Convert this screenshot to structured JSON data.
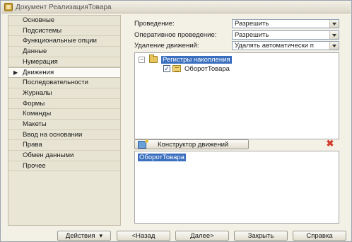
{
  "window": {
    "title": "Документ РеализацияТовара"
  },
  "nav": {
    "items": [
      {
        "label": "Основные"
      },
      {
        "label": "Подсистемы"
      },
      {
        "label": "Функциональные опции"
      },
      {
        "label": "Данные"
      },
      {
        "label": "Нумерация"
      },
      {
        "label": "Движения",
        "active": true
      },
      {
        "label": "Последовательности"
      },
      {
        "label": "Журналы"
      },
      {
        "label": "Формы"
      },
      {
        "label": "Команды"
      },
      {
        "label": "Макеты"
      },
      {
        "label": "Ввод на основании"
      },
      {
        "label": "Права"
      },
      {
        "label": "Обмен данными"
      },
      {
        "label": "Прочее"
      }
    ],
    "active_marker": "▶"
  },
  "settings": {
    "posting": {
      "label": "Проведение:",
      "value": "Разрешить"
    },
    "realtime_posting": {
      "label": "Оперативное проведение:",
      "value": "Разрешить"
    },
    "deletion": {
      "label": "Удаление движений:",
      "value": "Удалять автоматически п"
    }
  },
  "tree": {
    "root": {
      "toggle": "−",
      "label": "Регистры накопления"
    },
    "child": {
      "checked": "✓",
      "label": "ОборотТовара"
    }
  },
  "constructor": {
    "label": "Конструктор движений"
  },
  "delete_symbol": "✖",
  "movements_list": {
    "items": [
      "ОборотТовара"
    ]
  },
  "footer": {
    "actions": "Действия",
    "actions_arrow": "▾",
    "back": "<Назад",
    "next": "Далее>",
    "close": "Закрыть",
    "help": "Справка"
  }
}
